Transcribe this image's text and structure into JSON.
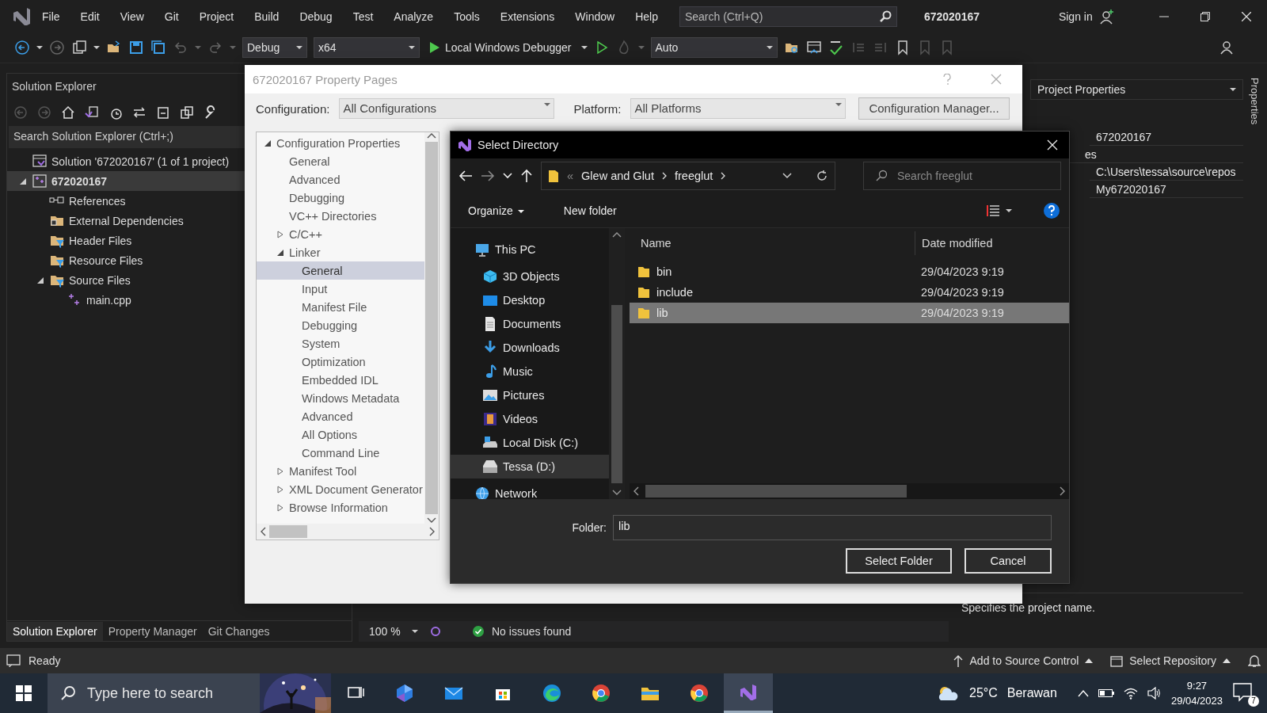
{
  "menu_bar": {
    "items": [
      "File",
      "Edit",
      "View",
      "Git",
      "Project",
      "Build",
      "Debug",
      "Test",
      "Analyze",
      "Tools",
      "Extensions",
      "Window",
      "Help"
    ],
    "search": {
      "placeholder": "Search (Ctrl+Q)"
    },
    "solution_name": "672020167",
    "sign_in": "Sign in"
  },
  "toolbar": {
    "configuration": "Debug",
    "platform": "x64",
    "debugger": "Local Windows Debugger",
    "target": "Auto"
  },
  "solution_explorer": {
    "title": "Solution Explorer",
    "search": {
      "placeholder": "Search Solution Explorer (Ctrl+;)"
    },
    "tree": [
      {
        "label": "Solution '672020167' (1 of 1 project)",
        "kind": "solution",
        "selected": false
      },
      {
        "label": "672020167",
        "kind": "project",
        "selected": true,
        "expanded": true,
        "children": [
          {
            "label": "References",
            "kind": "references",
            "selected": false
          },
          {
            "label": "External Dependencies",
            "kind": "external",
            "selected": false
          },
          {
            "label": "Header Files",
            "kind": "filter",
            "selected": false
          },
          {
            "label": "Resource Files",
            "kind": "filter",
            "selected": false
          },
          {
            "label": "Source Files",
            "kind": "filter",
            "selected": false,
            "expanded": true,
            "children": [
              {
                "label": "main.cpp",
                "kind": "cpp",
                "selected": false
              }
            ]
          }
        ]
      }
    ]
  },
  "bottom_tabs": [
    {
      "label": "Solution Explorer",
      "selected": true
    },
    {
      "label": "Property Manager",
      "selected": false
    },
    {
      "label": "Git Changes",
      "selected": false
    }
  ],
  "editor_status": {
    "zoom": "100 %",
    "issues": "No issues found"
  },
  "property_pages": {
    "title": "672020167 Property Pages",
    "configuration_label": "Configuration:",
    "configuration": "All Configurations",
    "platform_label": "Platform:",
    "platform": "All Platforms",
    "manager_button": "Configuration Manager...",
    "tree": [
      {
        "label": "Configuration Properties",
        "selected": false,
        "expanded": true,
        "children": [
          {
            "label": "General",
            "selected": false
          },
          {
            "label": "Advanced",
            "selected": false
          },
          {
            "label": "Debugging",
            "selected": false
          },
          {
            "label": "VC++ Directories",
            "selected": false
          },
          {
            "label": "C/C++",
            "selected": false,
            "expanded": false
          },
          {
            "label": "Linker",
            "selected": false,
            "expanded": true,
            "children": [
              {
                "label": "General",
                "selected": true
              },
              {
                "label": "Input",
                "selected": false
              },
              {
                "label": "Manifest File",
                "selected": false
              },
              {
                "label": "Debugging",
                "selected": false
              },
              {
                "label": "System",
                "selected": false
              },
              {
                "label": "Optimization",
                "selected": false
              },
              {
                "label": "Embedded IDL",
                "selected": false
              },
              {
                "label": "Windows Metadata",
                "selected": false
              },
              {
                "label": "Advanced",
                "selected": false
              },
              {
                "label": "All Options",
                "selected": false
              },
              {
                "label": "Command Line",
                "selected": false
              }
            ]
          },
          {
            "label": "Manifest Tool",
            "selected": false,
            "expanded": false
          },
          {
            "label": "XML Document Generator",
            "selected": false,
            "expanded": false
          },
          {
            "label": "Browse Information",
            "selected": false,
            "expanded": false
          }
        ]
      }
    ]
  },
  "select_directory": {
    "title": "Select Directory",
    "breadcrumb": [
      "«",
      "Glew and Glut",
      "freeglut"
    ],
    "search": {
      "placeholder": "Search freeglut"
    },
    "organize": "Organize",
    "new_folder": "New folder",
    "navigation": [
      {
        "label": "This PC",
        "kind": "pc",
        "selected": false,
        "top": true
      },
      {
        "label": "3D Objects",
        "kind": "cube",
        "selected": false
      },
      {
        "label": "Desktop",
        "kind": "desktop",
        "selected": false
      },
      {
        "label": "Documents",
        "kind": "documents",
        "selected": false
      },
      {
        "label": "Downloads",
        "kind": "downloads",
        "selected": false
      },
      {
        "label": "Music",
        "kind": "music",
        "selected": false
      },
      {
        "label": "Pictures",
        "kind": "pictures",
        "selected": false
      },
      {
        "label": "Videos",
        "kind": "videos",
        "selected": false
      },
      {
        "label": "Local Disk (C:)",
        "kind": "disk",
        "selected": false
      },
      {
        "label": "Tessa (D:)",
        "kind": "drive",
        "selected": true
      },
      {
        "label": "Network",
        "kind": "network",
        "selected": false,
        "top": true
      }
    ],
    "columns": [
      "Name",
      "Date modified"
    ],
    "files": [
      {
        "name": "bin",
        "date": "29/04/2023 9:19",
        "selected": false
      },
      {
        "name": "include",
        "date": "29/04/2023 9:19",
        "selected": false
      },
      {
        "name": "lib",
        "date": "29/04/2023 9:19",
        "selected": true
      }
    ],
    "folder_label": "Folder:",
    "folder_value": "lib",
    "buttons": [
      "Select Folder",
      "Cancel"
    ]
  },
  "properties_panel": {
    "header": "Project Properties",
    "tab": "Properties",
    "rows": [
      {
        "value": "672020167"
      },
      {
        "label": "es"
      },
      {
        "value": "C:\\Users\\tessa\\source\\repos"
      },
      {
        "value": "My672020167"
      }
    ],
    "description": "Specifies the project name."
  },
  "status_bar": {
    "text": "Ready",
    "source_control": "Add to Source Control",
    "repository": "Select Repository"
  },
  "taskbar": {
    "search": {
      "placeholder": "Type here to search"
    },
    "apps": [
      {
        "kind": "taskview",
        "active": false
      },
      {
        "kind": "hexagon",
        "active": false
      },
      {
        "kind": "mail",
        "active": false
      },
      {
        "kind": "store",
        "active": false
      },
      {
        "kind": "edge",
        "active": false
      },
      {
        "kind": "chrome",
        "active": false
      },
      {
        "kind": "folder",
        "active": false
      },
      {
        "kind": "chrome",
        "active": false
      },
      {
        "kind": "vs",
        "active": true
      }
    ],
    "temperature": "25°C",
    "weather": "Berawan",
    "time": "9:27",
    "date": "29/04/2023",
    "notifications": "7"
  }
}
